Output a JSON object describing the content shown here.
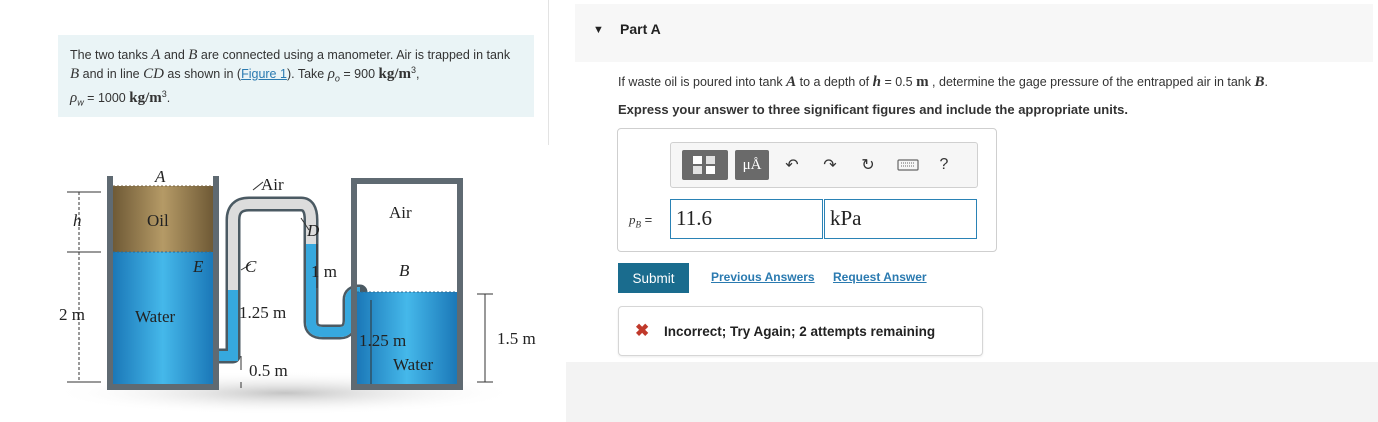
{
  "problem": {
    "text_1": "The two tanks ",
    "tank_a": "A",
    "text_2": " and ",
    "tank_b": "B",
    "text_3": " are connected using a manometer. Air is trapped in tank ",
    "tank_b2": "B",
    "text_4": " and in line ",
    "line_cd": "CD",
    "text_5": " as shown in (",
    "figure_link": "Figure 1",
    "text_6": "). Take ",
    "rho_o": "ρ",
    "rho_o_sub": "o",
    "text_7": " = 900 ",
    "unit_1": "kg/m",
    "unit_1_exp": "3",
    "text_8": ", ",
    "rho_w": "ρ",
    "rho_w_sub": "w",
    "text_9": " = 1000 ",
    "unit_2": "kg/m",
    "unit_2_exp": "3",
    "text_10": "."
  },
  "figure": {
    "label_a": "A",
    "label_air_top": "Air",
    "label_d": "D",
    "label_air_b": "Air",
    "label_h": "h",
    "label_oil": "Oil",
    "label_e": "E",
    "label_c": "C",
    "label_1m": "1 m",
    "label_b": "B",
    "label_2m": "2 m",
    "label_water_a": "Water",
    "label_125m": "1.25 m",
    "label_125m_b": "1.25 m",
    "label_15m": "1.5 m",
    "label_05m": "0.5 m",
    "label_water_b": "Water"
  },
  "part": {
    "caret": "▼",
    "title": "Part A"
  },
  "question": {
    "text_1": "If waste oil is poured into tank ",
    "tank": "A",
    "text_2": " to a depth of ",
    "h": "h",
    "text_3": " = 0.5  ",
    "unit": "m",
    "text_4": " , determine the gage pressure of the entrapped air in tank ",
    "tank_b": "B",
    "text_5": "."
  },
  "instruction": "Express your answer to three significant figures and include the appropriate units.",
  "toolbar": {
    "units_symbol": "μÅ",
    "undo": "↶",
    "redo": "↷",
    "reset": "↻",
    "help": "?"
  },
  "answer": {
    "label_var": "p",
    "label_sub": "B",
    "label_eq": " =",
    "value": "11.6",
    "unit": "kPa"
  },
  "buttons": {
    "submit": "Submit",
    "previous": "Previous Answers",
    "request": "Request Answer"
  },
  "feedback": {
    "icon": "✖",
    "text": "Incorrect; Try Again; 2 attempts remaining"
  },
  "colors": {
    "accent": "#1a6c8e",
    "link": "#2a7ab0",
    "error": "#c0392b",
    "water": "#29a7de",
    "oil": "#a08454"
  }
}
